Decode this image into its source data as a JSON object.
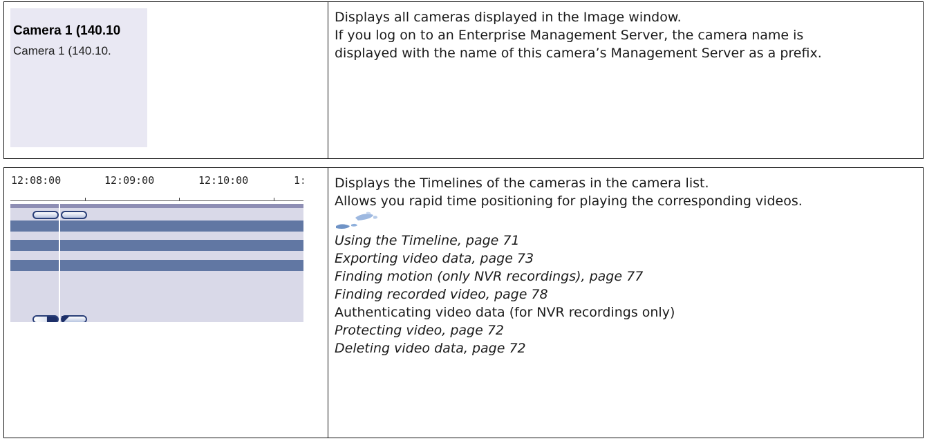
{
  "camera_row": {
    "thumb_camera_bold": "Camera 1 (140.10",
    "thumb_camera_plain": "Camera 1 (140.10.",
    "description": [
      "Displays all cameras displayed in the Image window.",
      "If you log on to an Enterprise Management Server, the camera name is",
      "displayed with the name of this camera’s Management Server as a prefix."
    ]
  },
  "timeline_row": {
    "tick_labels": [
      "12:08:00",
      "12:09:00",
      "12:10:00",
      "1:"
    ],
    "description": [
      "Displays the Timelines of the cameras in the camera list.",
      "Allows you rapid time positioning for playing the corresponding videos."
    ],
    "icon": "footprints-icon",
    "links": [
      {
        "text": "Using the Timeline, page 71",
        "italic": true
      },
      {
        "text": "Exporting video data, page 73",
        "italic": true
      },
      {
        "text": "Finding motion (only NVR recordings), page 77",
        "italic": true
      },
      {
        "text": "Finding recorded video, page 78",
        "italic": true
      },
      {
        "text": "Authenticating video data (for NVR recordings only)",
        "italic": false
      },
      {
        "text": "Protecting video, page 72",
        "italic": true
      },
      {
        "text": "Deleting video data, page 72",
        "italic": true
      }
    ]
  },
  "colors": {
    "timeline_bar": "#6177a3",
    "timeline_bg": "#d9d9e8",
    "thumb_bg": "#e9e8f3"
  }
}
